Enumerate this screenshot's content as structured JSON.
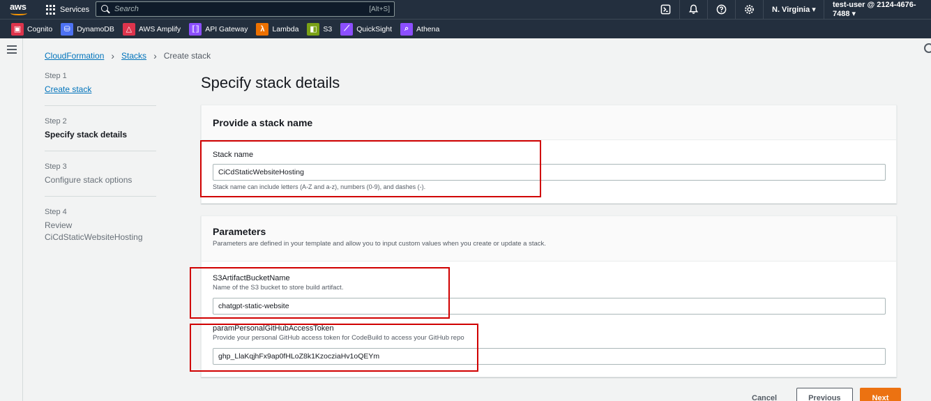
{
  "topbar": {
    "logo_text": "aws",
    "services_label": "Services",
    "search_placeholder": "Search",
    "search_shortcut": "[Alt+S]",
    "region": "N. Virginia ▾",
    "account": "test-user @ 2124-4676-7488 ▾"
  },
  "favorites": [
    {
      "label": "Cognito",
      "icon": "cognito-icon",
      "color": "#dd344c"
    },
    {
      "label": "DynamoDB",
      "icon": "dynamodb-icon",
      "color": "#4d72f3"
    },
    {
      "label": "AWS Amplify",
      "icon": "amplify-icon",
      "color": "#dd344c"
    },
    {
      "label": "API Gateway",
      "icon": "api-gateway-icon",
      "color": "#8c4fff"
    },
    {
      "label": "Lambda",
      "icon": "lambda-icon",
      "color": "#ed7100"
    },
    {
      "label": "S3",
      "icon": "s3-icon",
      "color": "#7aa116"
    },
    {
      "label": "QuickSight",
      "icon": "quicksight-icon",
      "color": "#8c4fff"
    },
    {
      "label": "Athena",
      "icon": "athena-icon",
      "color": "#8c4fff"
    }
  ],
  "breadcrumb": {
    "item1": "CloudFormation",
    "item2": "Stacks",
    "current": "Create stack"
  },
  "steps": [
    {
      "num": "Step 1",
      "label": "Create stack"
    },
    {
      "num": "Step 2",
      "label": "Specify stack details"
    },
    {
      "num": "Step 3",
      "label": "Configure stack options"
    },
    {
      "num": "Step 4",
      "label": "Review",
      "sub": "CiCdStaticWebsiteHosting"
    }
  ],
  "page_title": "Specify stack details",
  "stack_name_panel": {
    "heading": "Provide a stack name",
    "field_label": "Stack name",
    "value": "CiCdStaticWebsiteHosting",
    "constraint": "Stack name can include letters (A-Z and a-z), numbers (0-9), and dashes (-)."
  },
  "parameters_panel": {
    "heading": "Parameters",
    "description": "Parameters are defined in your template and allow you to input custom values when you create or update a stack.",
    "params": [
      {
        "name": "S3ArtifactBucketName",
        "desc": "Name of the S3 bucket to store build artifact.",
        "value": "chatgpt-static-website"
      },
      {
        "name": "paramPersonalGitHubAccessToken",
        "desc": "Provide your personal GitHub access token for CodeBuild to access your GitHub repo",
        "value": "ghp_LlaKqjhFx9ap0fHLoZ8k1KzocziaHv1oQEYm"
      }
    ]
  },
  "buttons": {
    "cancel": "Cancel",
    "previous": "Previous",
    "next": "Next"
  },
  "colors": {
    "nav_bg": "#232f3e",
    "link": "#0073bb",
    "primary": "#ec7211",
    "highlight": "#d00000"
  }
}
